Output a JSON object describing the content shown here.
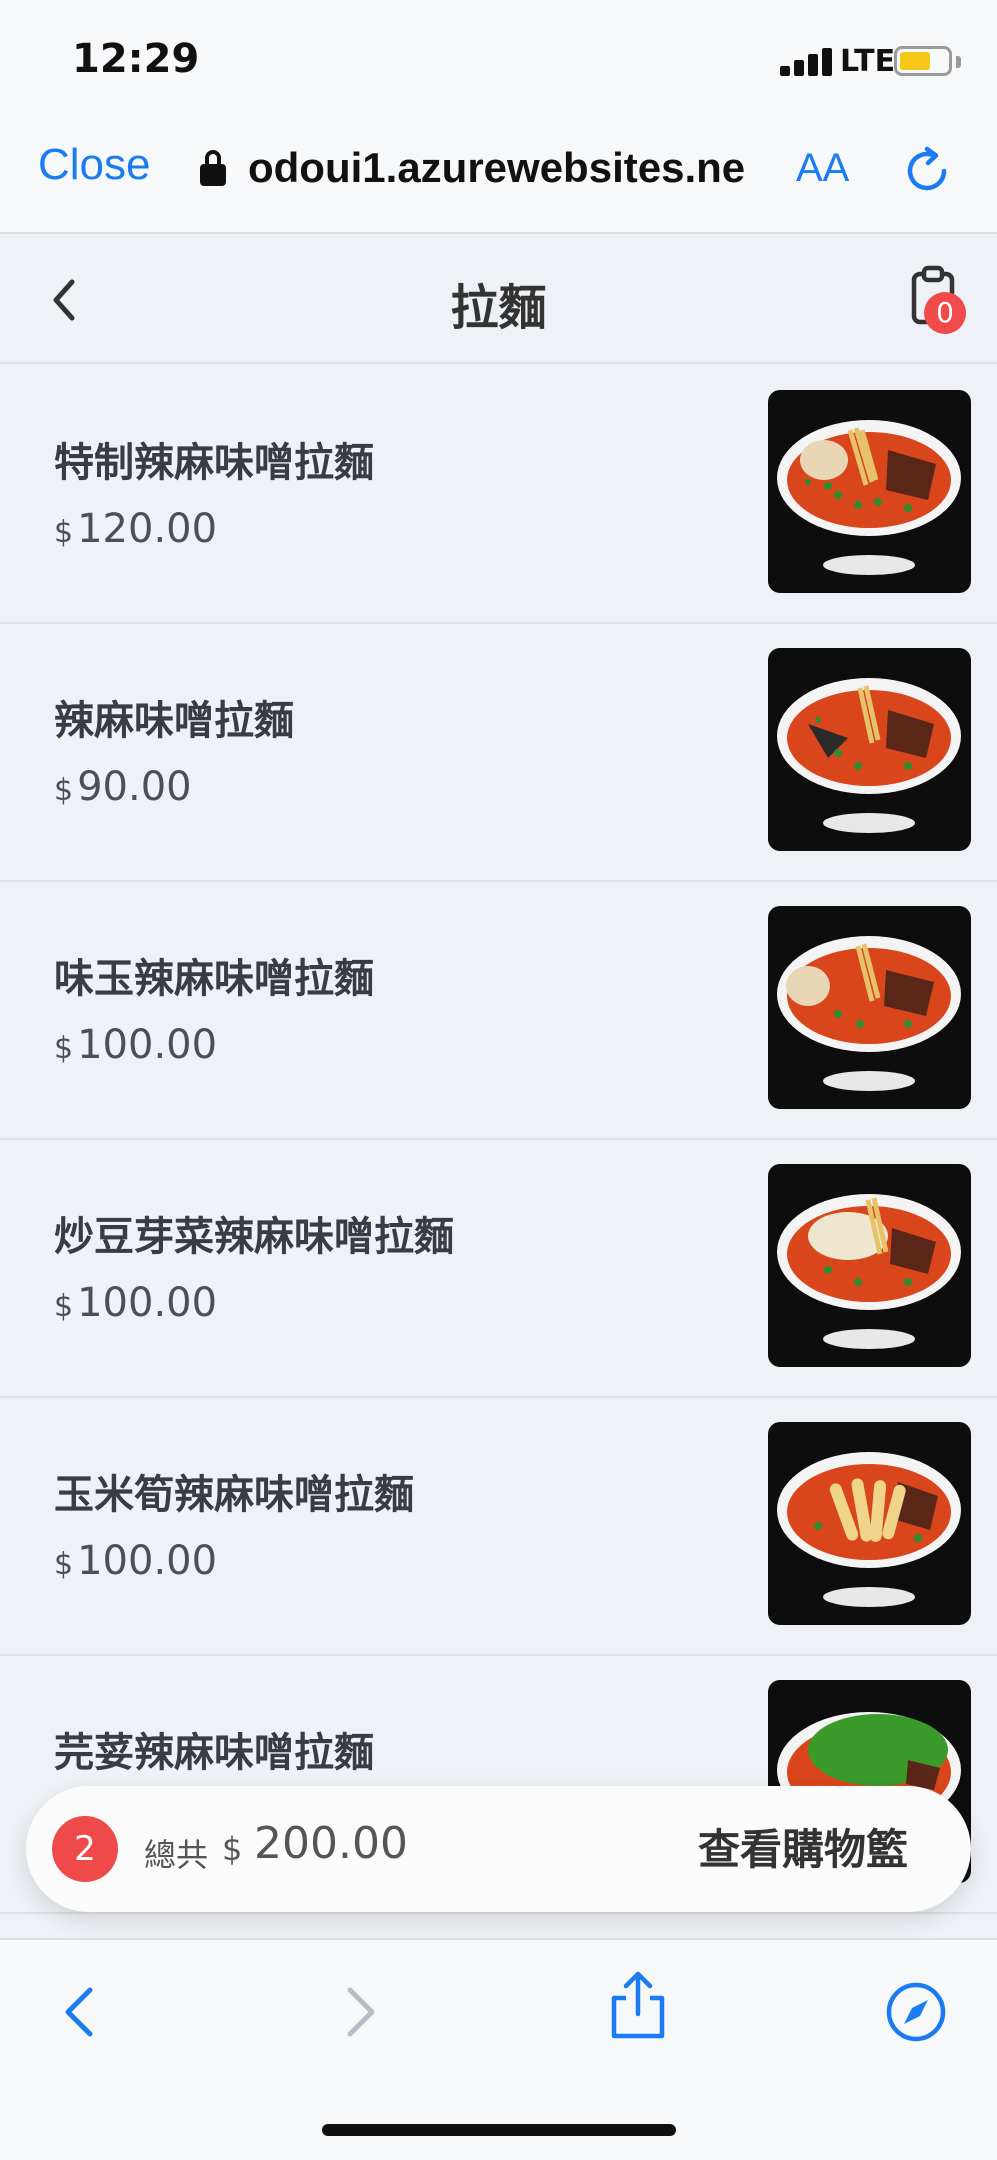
{
  "status_bar": {
    "time": "12:29",
    "network": "LTE"
  },
  "browser": {
    "close_label": "Close",
    "url": "odoui1.azurewebsites.ne",
    "text_size_label": "AA"
  },
  "header": {
    "title": "拉麵",
    "cart_count": "0"
  },
  "menu": {
    "items": [
      {
        "name": "特制辣麻味噌拉麵",
        "currency": "$",
        "price": "120.00",
        "photo_icon": "ramen-bowl-egg"
      },
      {
        "name": "辣麻味噌拉麵",
        "currency": "$",
        "price": "90.00",
        "photo_icon": "ramen-bowl"
      },
      {
        "name": "味玉辣麻味噌拉麵",
        "currency": "$",
        "price": "100.00",
        "photo_icon": "ramen-bowl-egg"
      },
      {
        "name": "炒豆芽菜辣麻味噌拉麵",
        "currency": "$",
        "price": "100.00",
        "photo_icon": "ramen-bowl-sprouts"
      },
      {
        "name": "玉米筍辣麻味噌拉麵",
        "currency": "$",
        "price": "100.00",
        "photo_icon": "ramen-bowl-babycorn"
      },
      {
        "name": "芫荽辣麻味噌拉麵",
        "currency": "$",
        "price": "",
        "photo_icon": "ramen-bowl-coriander"
      }
    ]
  },
  "cart_summary": {
    "item_count": "2",
    "total_label": "總共",
    "currency": "$",
    "total_amount": "200.00",
    "view_cart_label": "查看購物籃"
  },
  "colors": {
    "accent_blue": "#1a7cf0",
    "badge_red": "#f04a4a",
    "background": "#eef1f5"
  }
}
